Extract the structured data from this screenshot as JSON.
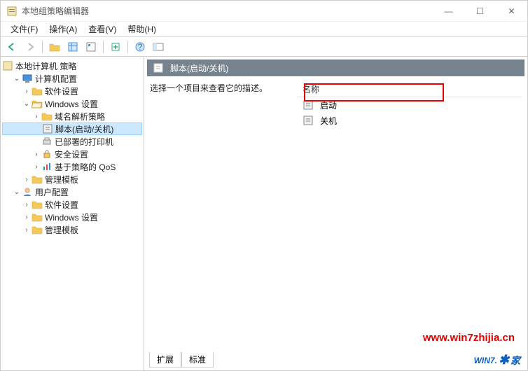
{
  "titlebar": {
    "title": "本地组策略编辑器"
  },
  "win_controls": {
    "min": "—",
    "max": "☐",
    "close": "✕"
  },
  "menu": {
    "file": "文件(F)",
    "action": "操作(A)",
    "view": "查看(V)",
    "help": "帮助(H)"
  },
  "tree": {
    "root": "本地计算机 策略",
    "computer": "计算机配置",
    "computer_children": {
      "software": "软件设置",
      "windows": "Windows 设置",
      "windows_children": {
        "nrp": "域名解析策略",
        "scripts": "脚本(启动/关机)",
        "printers": "已部署的打印机",
        "security": "安全设置",
        "pqos": "基于策略的 QoS"
      },
      "admin": "管理模板"
    },
    "user": "用户配置",
    "user_children": {
      "software": "软件设置",
      "windows": "Windows 设置",
      "admin": "管理模板"
    }
  },
  "main": {
    "header": "脚本(启动/关机)",
    "desc": "选择一个项目来查看它的描述。",
    "column": "名称",
    "rows": {
      "startup": "启动",
      "shutdown": "关机"
    }
  },
  "tabs": {
    "extended": "扩展",
    "standard": "标准"
  },
  "watermark": "www.win7zhijia.cn",
  "logo": {
    "text": "WIN7.",
    "suffix": "家"
  }
}
